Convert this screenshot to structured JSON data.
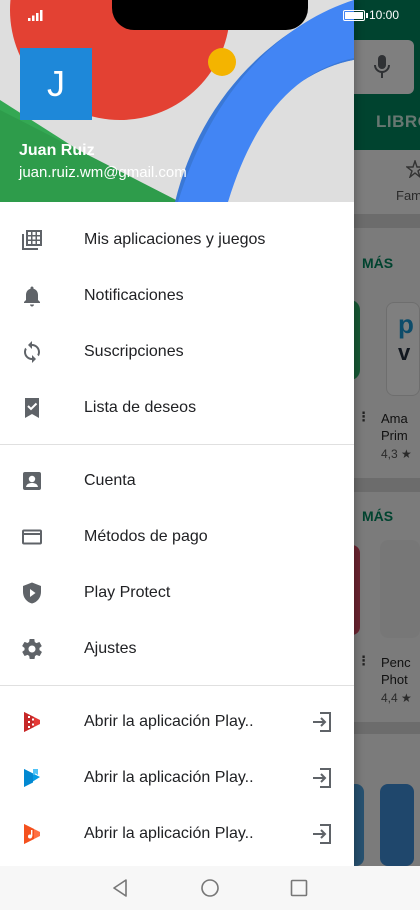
{
  "status_bar": {
    "time": "10:00",
    "battery_level": 0.9
  },
  "background": {
    "search_cut_text": "LIBRO",
    "category_cut": "Fam",
    "section_more_1": "MÁS",
    "section_more_2": "MÁS",
    "tile_brand_cut_line1": "p",
    "tile_brand_cut_line2": "v",
    "app1_name": "Ama",
    "app1_name2": "Prim",
    "app1_rating": "4,3 ★",
    "app2_name": "Penc",
    "app2_name2": "Phot",
    "app2_rating": "4,4 ★"
  },
  "drawer": {
    "account": {
      "avatar_letter": "J",
      "name": "Juan Ruiz",
      "email": "juan.ruiz.wm@gmail.com"
    },
    "group1": [
      {
        "label": "Mis aplicaciones y juegos",
        "icon": "apps-grid-icon"
      },
      {
        "label": "Notificaciones",
        "icon": "bell-icon"
      },
      {
        "label": "Suscripciones",
        "icon": "refresh-icon"
      },
      {
        "label": "Lista de deseos",
        "icon": "bookmark-check-icon"
      }
    ],
    "group2": [
      {
        "label": "Cuenta",
        "icon": "account-box-icon"
      },
      {
        "label": "Métodos de pago",
        "icon": "credit-card-icon"
      },
      {
        "label": "Play Protect",
        "icon": "shield-play-icon"
      },
      {
        "label": "Ajustes",
        "icon": "gear-icon"
      }
    ],
    "group3": [
      {
        "label": "Abrir la aplicación Play..",
        "icon": "play-movies-icon"
      },
      {
        "label": "Abrir la aplicación Play..",
        "icon": "play-books-icon"
      },
      {
        "label": "Abrir la aplicación Play..",
        "icon": "play-music-icon"
      }
    ]
  },
  "colors": {
    "play_green": "#01875f",
    "avatar_blue": "#1e88d9",
    "icon_grey": "#5f6368"
  }
}
